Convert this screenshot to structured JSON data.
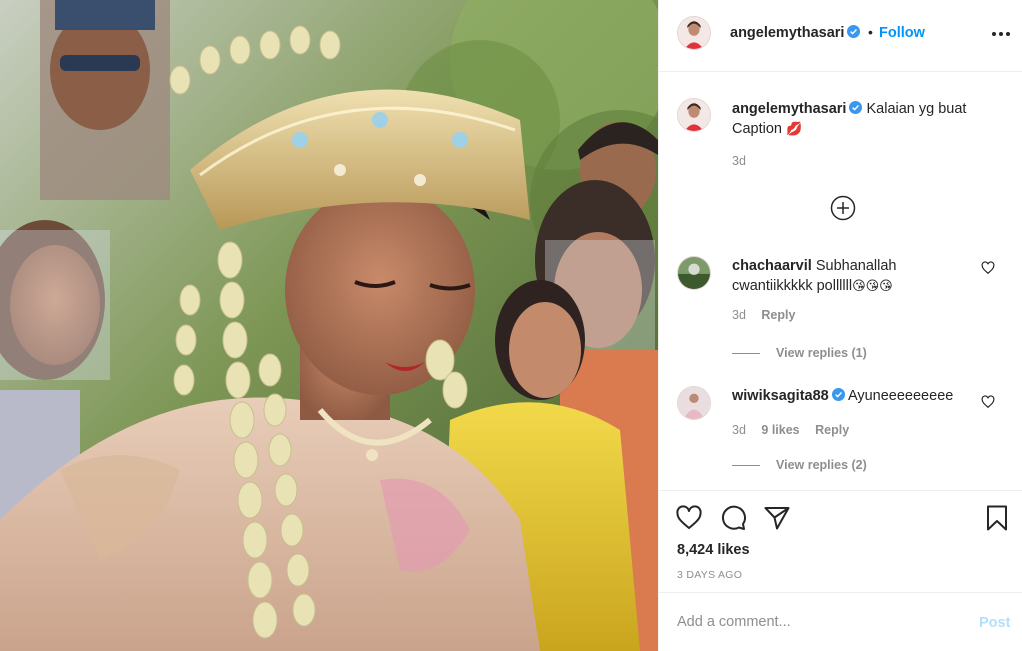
{
  "colors": {
    "accent": "#0095f6",
    "post_disabled": "#b2dffc",
    "secondary_text": "#8e8e8e",
    "border": "#efefef",
    "verified": "#3897f0"
  },
  "header": {
    "username": "angelemythasari",
    "separator": "•",
    "follow_label": "Follow",
    "more_icon": "more-dots-icon"
  },
  "caption": {
    "username": "angelemythasari",
    "text": "Kalaian yg buat Caption",
    "emoji": "💋",
    "time": "3d"
  },
  "comments": [
    {
      "username": "chachaarvil",
      "text": "Subhanallah cwantiikkkkk pollllll",
      "emoji": "😘😘😘",
      "time": "3d",
      "likes": "",
      "reply_label": "Reply",
      "view_replies": "View replies (1)"
    },
    {
      "username": "wiwiksagita88",
      "text": "Ayuneeeeeeeee",
      "emoji": "",
      "time": "3d",
      "likes": "9 likes",
      "reply_label": "Reply",
      "view_replies": "View replies (2)"
    }
  ],
  "actions": {
    "like_icon": "heart-icon",
    "comment_icon": "comment-bubble-icon",
    "share_icon": "paper-plane-icon",
    "save_icon": "bookmark-icon",
    "likes_count": "8,424 likes",
    "posted_ago": "3 DAYS AGO"
  },
  "add_comment": {
    "placeholder": "Add a comment...",
    "post_label": "Post"
  }
}
